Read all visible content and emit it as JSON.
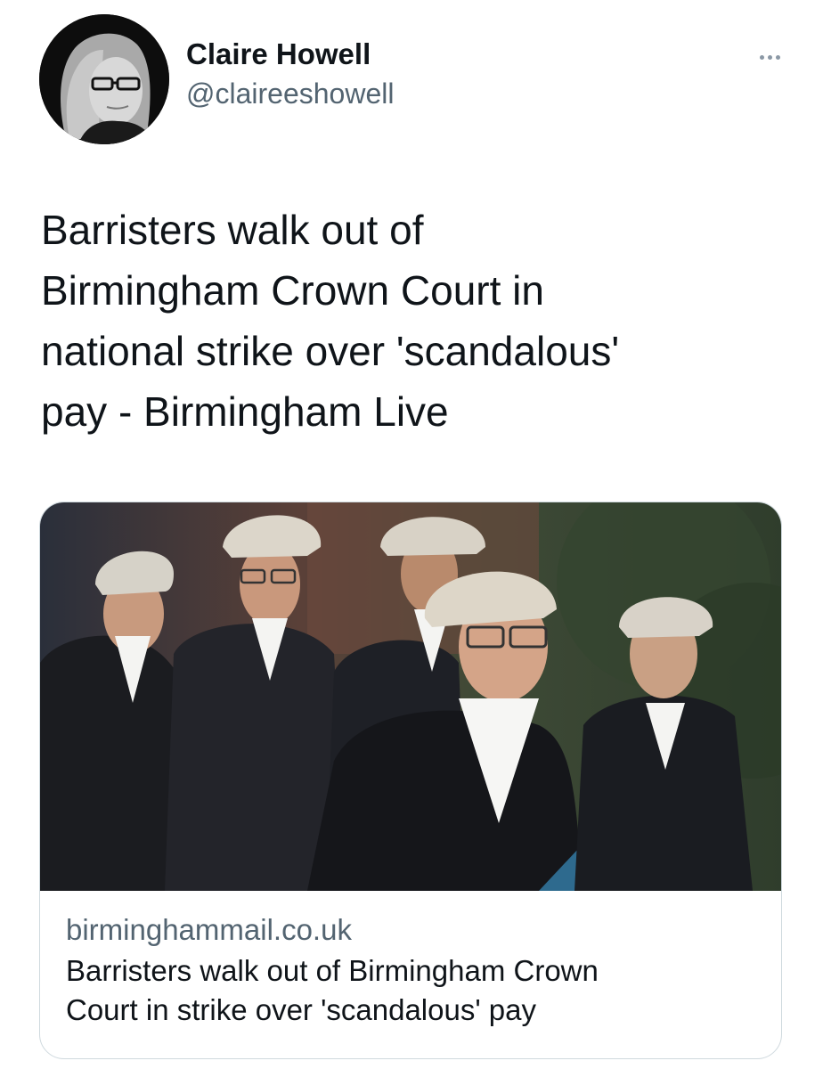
{
  "author": {
    "display_name": "Claire Howell",
    "handle": "@claireeshowell",
    "avatar_icon": "profile-photo"
  },
  "more_icon": "more-horizontal-icon",
  "tweet": {
    "text_lines": [
      "Barristers walk out of",
      "Birmingham Crown Court in",
      "national strike over 'scandalous'",
      "pay - Birmingham Live"
    ]
  },
  "card": {
    "image_icon": "barristers-photo",
    "domain": "birminghammail.co.uk",
    "title_lines": [
      "Barristers walk out of Birmingham Crown",
      "Court in strike over 'scandalous' pay"
    ]
  },
  "colors": {
    "text_primary": "#0f1419",
    "text_secondary": "#536471",
    "border": "#cfd9de"
  }
}
